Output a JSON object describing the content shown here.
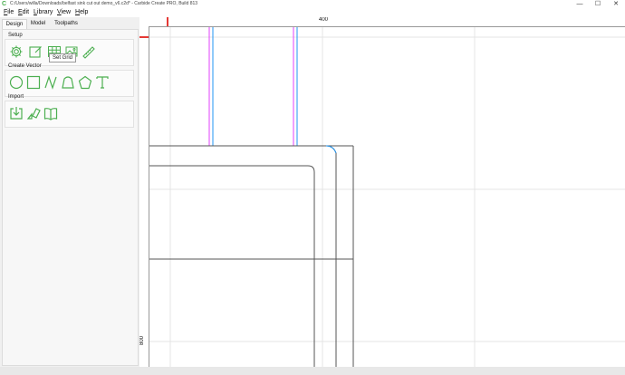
{
  "window": {
    "title": "C:/Users/willa/Downloads/belfast sink cut out demo_v6.c2d* - Carbide Create PRO, Build 813",
    "minimize_glyph": "—",
    "maximize_glyph": "☐",
    "close_glyph": "✕"
  },
  "menu": [
    "File",
    "Edit",
    "Library",
    "View",
    "Help"
  ],
  "tabs": [
    "Design",
    "Model",
    "Toolpaths"
  ],
  "sections": {
    "setup": "Setup",
    "create_vector": "Create Vector",
    "import": "Import"
  },
  "tooltip": "Set Grid",
  "ruler": {
    "top_label": "400",
    "left_label": "800"
  },
  "colors": {
    "accent": "#4caf50",
    "ruler_marker": "#e53935",
    "guide_magenta": "#e040fb",
    "guide_blue": "#2196f3"
  },
  "icons": {
    "setup": [
      "gear-icon",
      "edit-job-icon",
      "set-grid-icon",
      "image-icon",
      "measure-icon"
    ],
    "create_vector": [
      "circle-icon",
      "rectangle-icon",
      "curve-icon",
      "polyline-icon",
      "polygon-icon",
      "text-icon"
    ],
    "import": [
      "import-icon",
      "import-svg-icon",
      "library-book-icon"
    ]
  }
}
